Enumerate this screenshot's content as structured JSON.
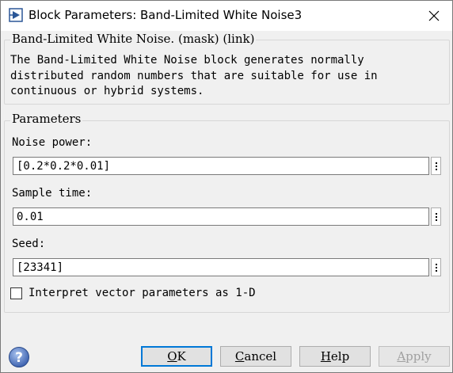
{
  "window": {
    "title": "Block Parameters: Band-Limited White Noise3",
    "app_icon": "simulink-block-icon",
    "close_icon": "close-icon"
  },
  "mask": {
    "title": "Band-Limited White Noise. (mask) (link)",
    "description": "The Band-Limited White Noise block generates normally\ndistributed random numbers that are suitable for use in\ncontinuous or hybrid systems."
  },
  "parameters": {
    "title": "Parameters",
    "noise_power": {
      "label": "Noise power:",
      "value": "[0.2*0.2*0.01]"
    },
    "sample_time": {
      "label": "Sample time:",
      "value": "0.01"
    },
    "seed": {
      "label": "Seed:",
      "value": "[23341]"
    },
    "interpret_vector": {
      "label": "Interpret vector parameters as 1-D",
      "checked": false
    }
  },
  "buttons": {
    "ok": {
      "mnemonic": "O",
      "rest": "K"
    },
    "cancel": {
      "mnemonic": "C",
      "rest": "ancel"
    },
    "help": {
      "mnemonic": "H",
      "rest": "elp"
    },
    "apply": {
      "mnemonic": "A",
      "rest": "pply",
      "disabled": true
    },
    "help_icon": "help-question-icon"
  },
  "colors": {
    "focus_border": "#0078d7",
    "help_icon": "#4a77c4"
  }
}
